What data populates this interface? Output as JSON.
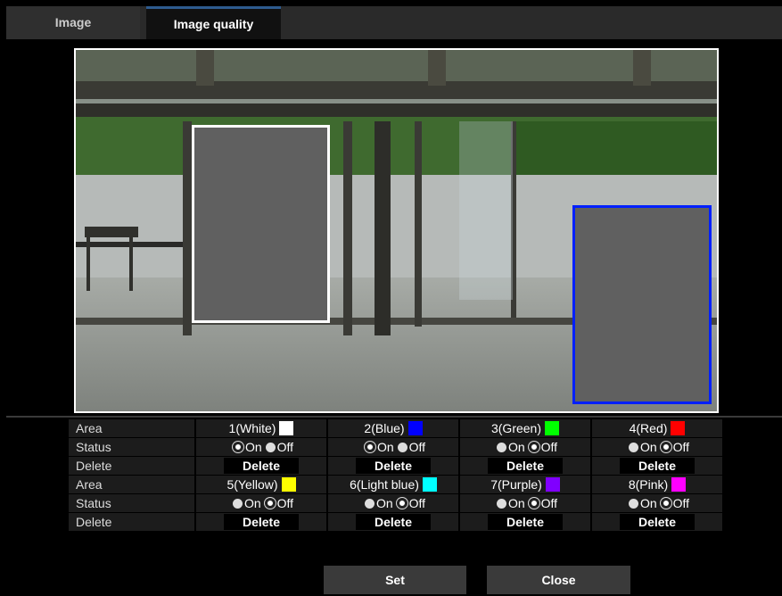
{
  "tabs": [
    {
      "label": "Image"
    },
    {
      "label": "Image quality"
    }
  ],
  "table": {
    "labels": {
      "area": "Area",
      "status": "Status",
      "delete": "Delete"
    },
    "on_label": "On",
    "off_label": "Off",
    "delete_button": "Delete",
    "areas": [
      {
        "name": "1(White)",
        "color": "#ffffff",
        "status": "On"
      },
      {
        "name": "2(Blue)",
        "color": "#0000ff",
        "status": "On"
      },
      {
        "name": "3(Green)",
        "color": "#00ff00",
        "status": "Off"
      },
      {
        "name": "4(Red)",
        "color": "#ff0000",
        "status": "Off"
      },
      {
        "name": "5(Yellow)",
        "color": "#ffff00",
        "status": "Off"
      },
      {
        "name": "6(Light blue)",
        "color": "#00ffff",
        "status": "Off"
      },
      {
        "name": "7(Purple)",
        "color": "#8000ff",
        "status": "Off"
      },
      {
        "name": "8(Pink)",
        "color": "#ff00ff",
        "status": "Off"
      }
    ]
  },
  "buttons": {
    "set": "Set",
    "close": "Close"
  }
}
